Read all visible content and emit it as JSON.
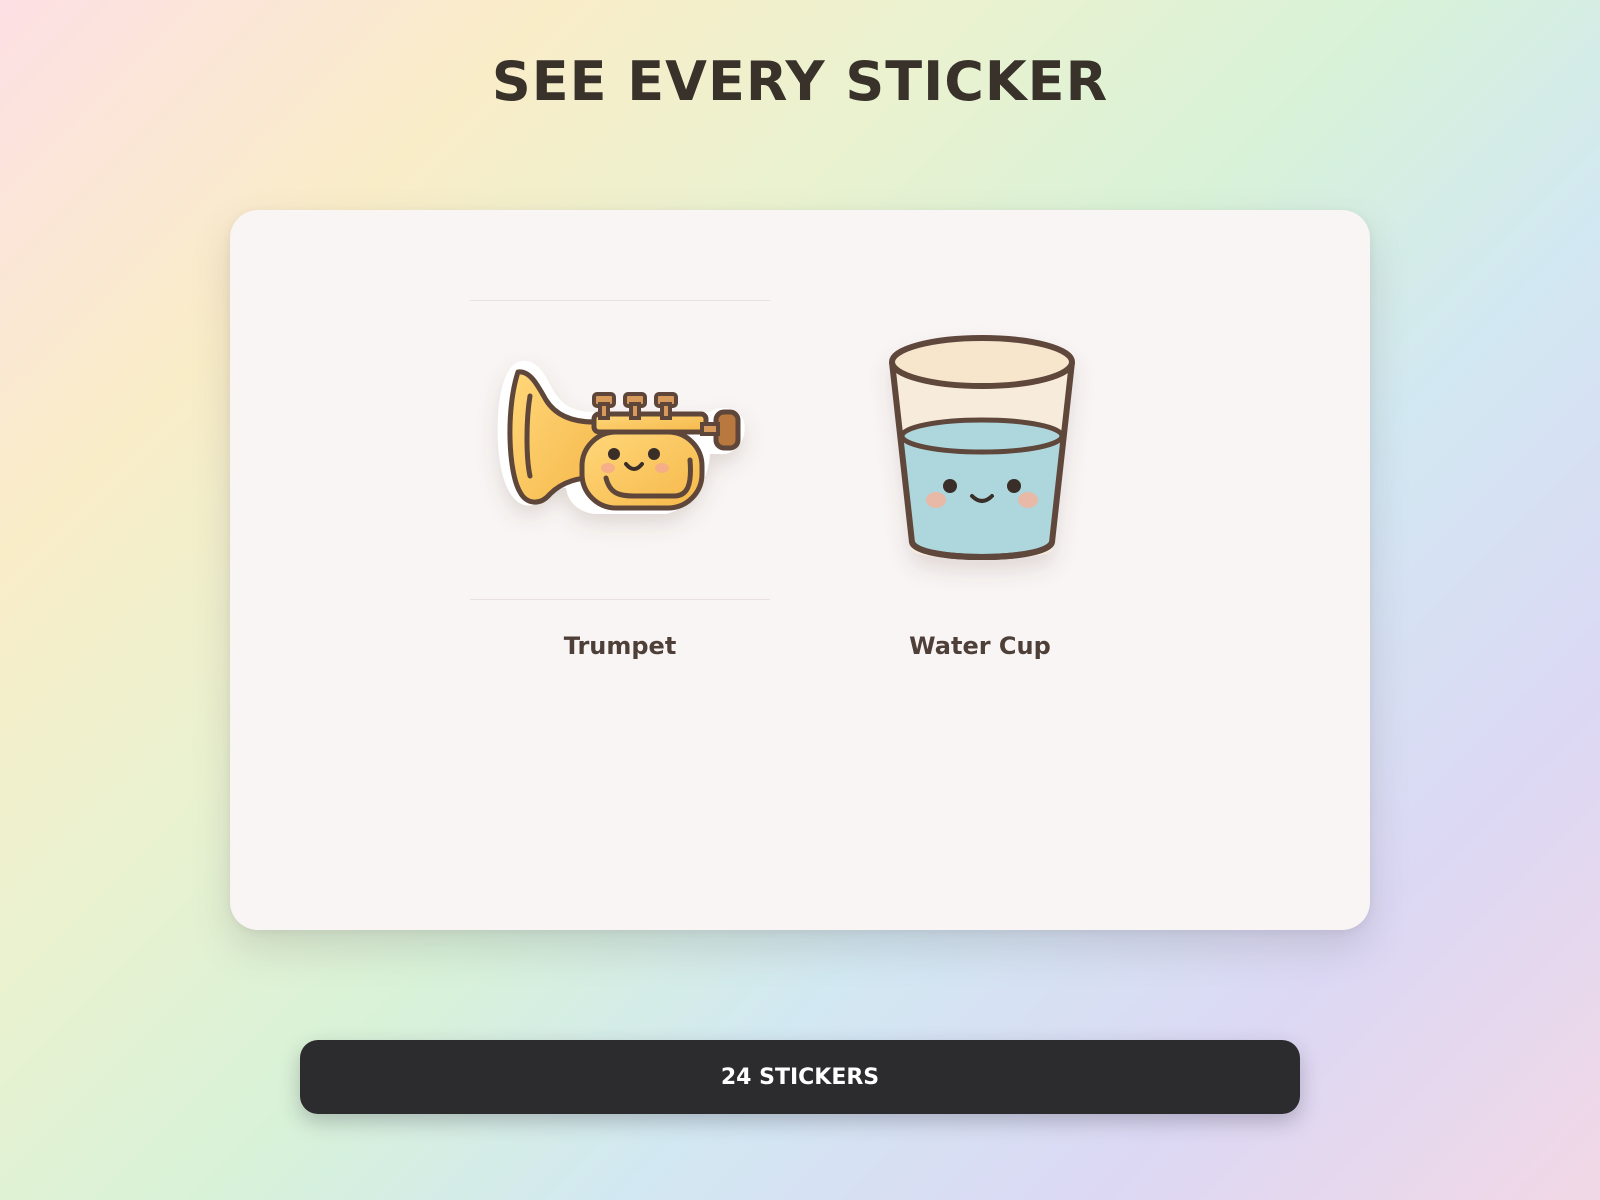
{
  "page": {
    "title": "SEE EVERY STICKER"
  },
  "stickers": [
    {
      "label": "Trumpet",
      "icon": "trumpet-icon",
      "selected": true
    },
    {
      "label": "Water Cup",
      "icon": "water-cup-icon",
      "selected": false
    }
  ],
  "footer": {
    "count_label": "24 STICKERS"
  },
  "colors": {
    "title": "#38322b",
    "card": "#f9f5f5",
    "label": "#4e4038",
    "button_bg": "#2c2b2e",
    "button_text": "#ffffff",
    "outline": "#5e463a",
    "trumpet_gold": "#fcc858",
    "water": "#a9d6dd",
    "cheek": "#f2b49c"
  }
}
